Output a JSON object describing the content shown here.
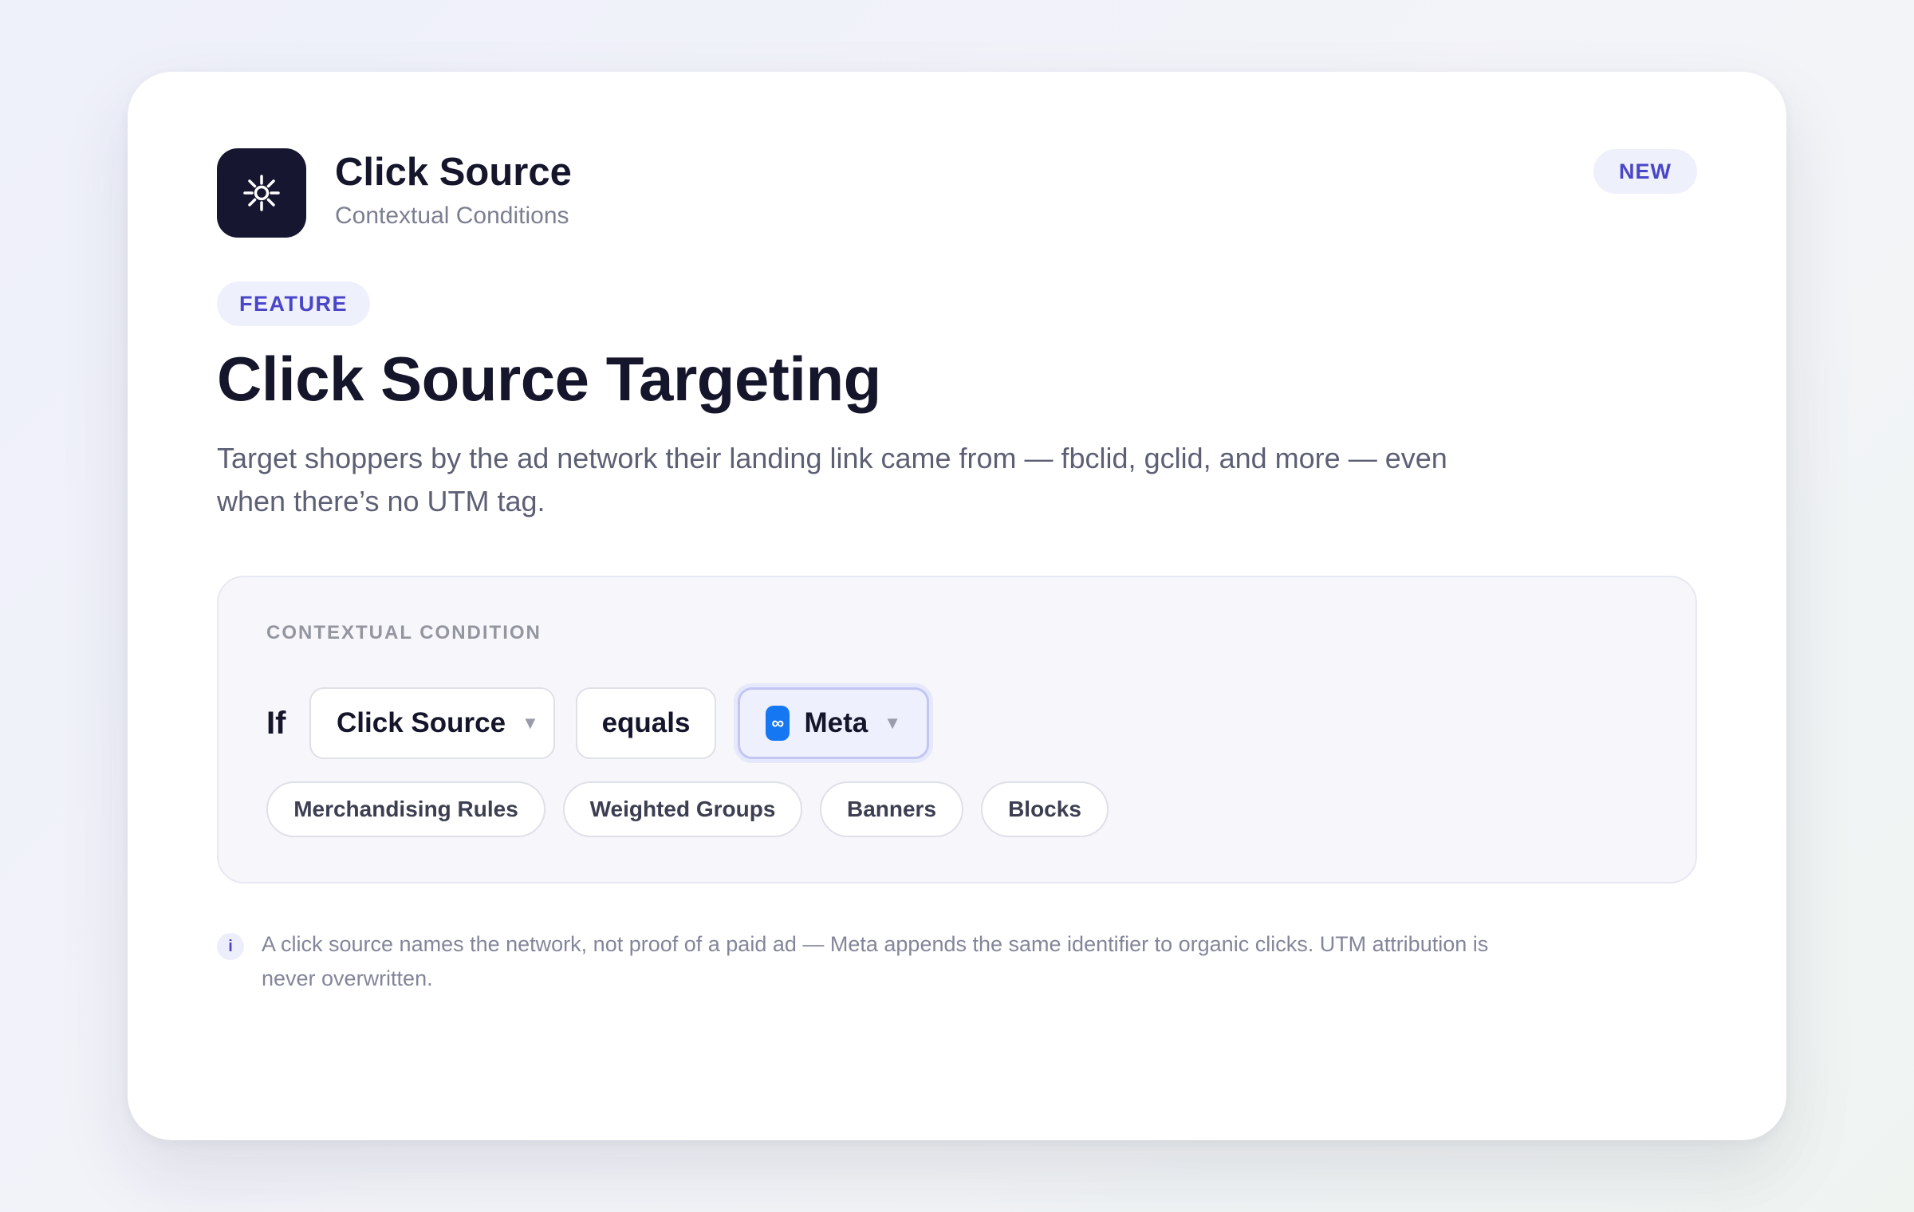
{
  "header": {
    "app_icon": "gear-sparkle-icon",
    "title": "Click Source",
    "subtitle": "Contextual Conditions",
    "new_badge": "NEW"
  },
  "feature": {
    "badge": "FEATURE",
    "headline": "Click Source Targeting",
    "description": "Target shoppers by the ad network their landing link came from — fbclid, gclid, and more — even when there’s no UTM tag."
  },
  "condition": {
    "label": "CONTEXTUAL CONDITION",
    "if_label": "If",
    "field": "Click Source",
    "operator": "equals",
    "value": "Meta",
    "value_icon": "meta-icon",
    "scopes": [
      "Merchandising Rules",
      "Weighted Groups",
      "Banners",
      "Blocks"
    ]
  },
  "note": {
    "icon": "info-icon",
    "text": "A click source names the network, not proof of a paid ad — Meta appends the same identifier to organic clicks. UTM attribution is never overwritten."
  },
  "colors": {
    "accent": "#4a46c7",
    "app_icon_bg": "#161630",
    "meta_blue": "#1677f2",
    "heading": "#15152b"
  }
}
